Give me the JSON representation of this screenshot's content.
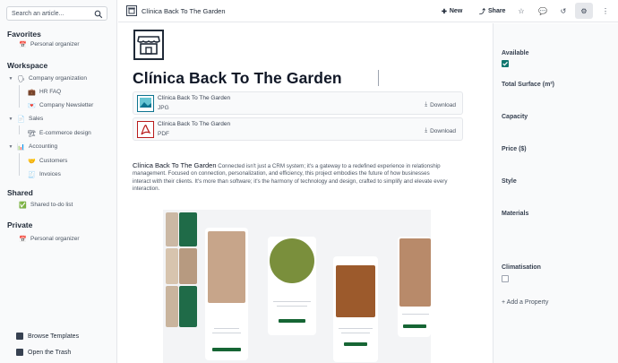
{
  "sidebar": {
    "search_placeholder": "Search an article...",
    "sections": {
      "favorites": "Favorites",
      "workspace": "Workspace",
      "shared": "Shared",
      "private": "Private"
    },
    "favorites": [
      {
        "label": "Personal organizer",
        "icon": "calendar-icon"
      }
    ],
    "workspace": [
      {
        "label": "Company organization",
        "icon": "chat-bubble-icon"
      },
      {
        "label": "HR FAQ",
        "icon": "briefcase-icon"
      },
      {
        "label": "Company Newsletter",
        "icon": "envelope-icon"
      },
      {
        "label": "Sales",
        "icon": "document-icon"
      },
      {
        "label": "E-commerce design",
        "icon": "builder-icon"
      },
      {
        "label": "Accounting",
        "icon": "bar-chart-icon"
      },
      {
        "label": "Customers",
        "icon": "handshake-icon"
      },
      {
        "label": "Invoices",
        "icon": "receipt-icon"
      }
    ],
    "shared": [
      {
        "label": "Shared to-do list",
        "icon": "check-icon"
      }
    ],
    "private": [
      {
        "label": "Personal organizer",
        "icon": "calendar-icon"
      }
    ],
    "bottom": {
      "templates": "Browse Templates",
      "trash": "Open the Trash"
    }
  },
  "topbar": {
    "title": "Clínica Back To The Garden",
    "new_label": "New",
    "share_label": "Share"
  },
  "document": {
    "title": "Clínica Back To The Garden",
    "files": [
      {
        "name": "Clínica Back To The Garden",
        "type": "JPG",
        "action": "Download"
      },
      {
        "name": "Clínica Back To The Garden",
        "type": "PDF",
        "action": "Download"
      }
    ],
    "lead": "Clínica Back To The Garden",
    "body": " Connected isn't just a CRM system; it's a gateway to a redefined experience in relationship management. Focused on connection, personalization, and efficiency, this project embodies the future of how businesses interact with their clients. It's more than software; it's the harmony of technology and design, crafted to simplify and elevate every interaction."
  },
  "properties": {
    "available": "Available",
    "surface": "Total Surface (m²)",
    "capacity": "Capacity",
    "price": "Price ($)",
    "style": "Style",
    "materials": "Materials",
    "climatisation": "Climatisation",
    "add": "+ Add a Property"
  },
  "colors": {
    "accent": "#0f766e",
    "green": "#1f6b48"
  }
}
